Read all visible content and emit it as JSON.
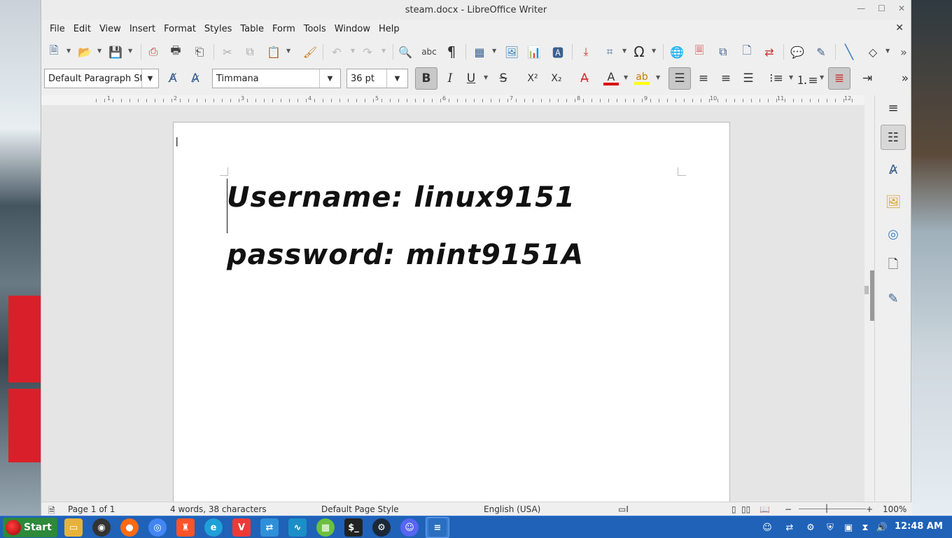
{
  "window": {
    "title": "steam.docx - LibreOffice Writer"
  },
  "menubar": {
    "items": [
      "File",
      "Edit",
      "View",
      "Insert",
      "Format",
      "Styles",
      "Table",
      "Form",
      "Tools",
      "Window",
      "Help"
    ]
  },
  "format_toolbar": {
    "paragraph_style": "Default Paragraph St",
    "font_name": "Timmana",
    "font_size": "36 pt",
    "bold_active": true,
    "align_left_active": true
  },
  "ruler": {
    "numbers": [
      "1",
      "2",
      "3",
      "4",
      "5",
      "6",
      "7",
      "8",
      "9",
      "10",
      "11",
      "12"
    ]
  },
  "document": {
    "lines": [
      "Username:  linux9151",
      "password:  mint9151A"
    ]
  },
  "statusbar": {
    "page": "Page 1 of 1",
    "word_count": "4 words, 38 characters",
    "page_style": "Default Page Style",
    "language": "English (USA)",
    "zoom": "100%"
  },
  "taskbar": {
    "start_label": "Start",
    "clock": "12:48 AM"
  },
  "colors": {
    "taskbar": "#1f62b8",
    "start_button": "#2c8a3a",
    "font_color_bar": "#d90000",
    "highlight_bar": "#ffff00"
  }
}
